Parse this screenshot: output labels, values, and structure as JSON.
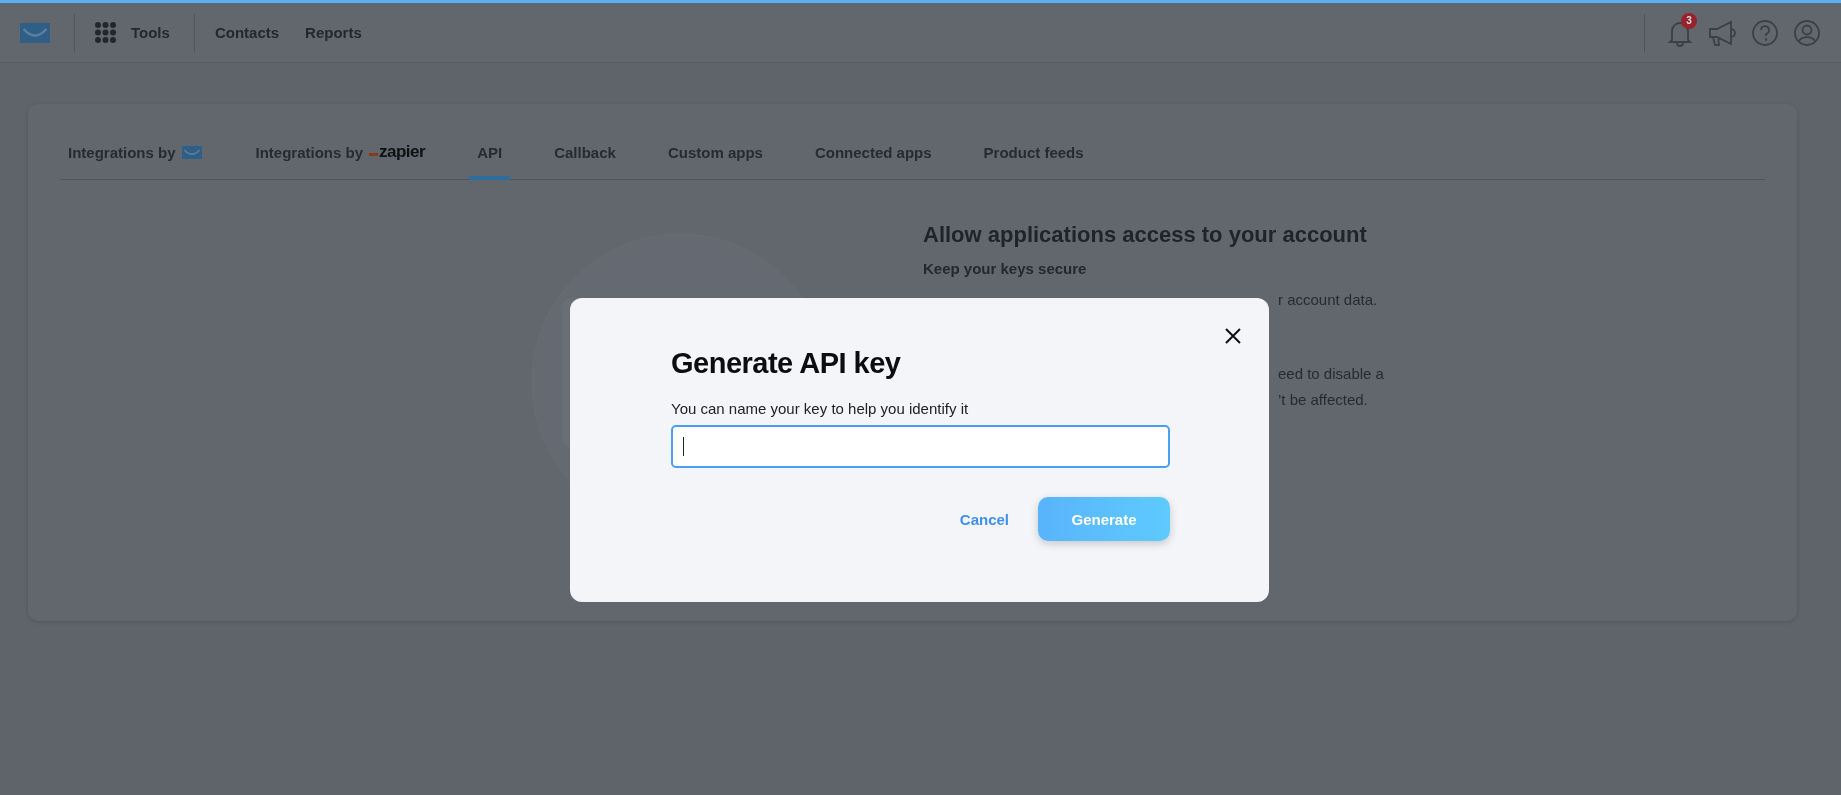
{
  "topbar": {
    "nav": [
      {
        "kind": "apps",
        "label": "Tools"
      },
      {
        "kind": "link",
        "label": "Contacts"
      },
      {
        "kind": "link",
        "label": "Reports"
      }
    ],
    "notifications_badge": "3"
  },
  "tabs": [
    {
      "kind": "mail_logo",
      "label": "Integrations by",
      "selected": false
    },
    {
      "kind": "zapier_logo",
      "label": "Integrations by",
      "logo_text": "zapier",
      "selected": false
    },
    {
      "kind": "text",
      "label": "API",
      "selected": true
    },
    {
      "kind": "text",
      "label": "Callback",
      "selected": false
    },
    {
      "kind": "text",
      "label": "Custom apps",
      "selected": false
    },
    {
      "kind": "text",
      "label": "Connected apps",
      "selected": false
    },
    {
      "kind": "text",
      "label": "Product feeds",
      "selected": false
    }
  ],
  "info": {
    "title": "Allow applications access to your account",
    "subtitle": "Keep your keys secure",
    "fragments": [
      "r account data.",
      "eed to disable a",
      "’t be affected."
    ]
  },
  "modal": {
    "title": "Generate API key",
    "field_label": "You can name your key to help you identify it",
    "focused": true,
    "cancel": "Cancel",
    "submit": "Generate"
  }
}
